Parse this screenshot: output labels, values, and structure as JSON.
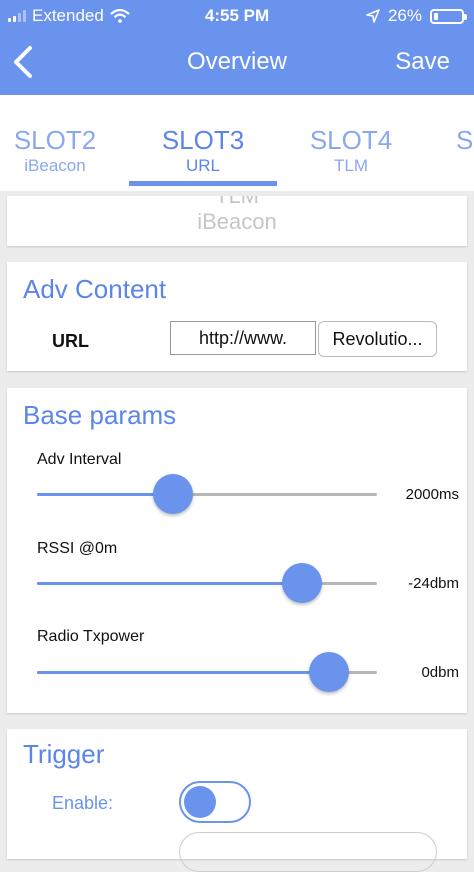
{
  "status_bar": {
    "carrier": "Extended",
    "time": "4:55 PM",
    "battery": "26%",
    "battery_level": 0.26,
    "signal_bars": 2
  },
  "nav": {
    "title": "Overview",
    "save_label": "Save"
  },
  "tabs": [
    {
      "name": "SLOT2",
      "sub": "iBeacon"
    },
    {
      "name": "SLOT3",
      "sub": "URL",
      "active": true
    },
    {
      "name": "SLOT4",
      "sub": "TLM"
    },
    {
      "name": "S",
      "sub": ""
    }
  ],
  "frame_picker": {
    "items": [
      "TLM",
      "iBeacon"
    ]
  },
  "adv_content": {
    "title": "Adv Content",
    "url_label": "URL",
    "url_prefix": "http://www.",
    "url_value": "Revolutio..."
  },
  "base_params": {
    "title": "Base params",
    "params": [
      {
        "label": "Adv Interval",
        "value": "2000ms",
        "level": 0.4
      },
      {
        "label": "RSSI @0m",
        "value": "-24dbm",
        "level": 0.78
      },
      {
        "label": "Radio Txpower",
        "value": "0dbm",
        "level": 0.86
      }
    ]
  },
  "trigger": {
    "title": "Trigger",
    "enable_label": "Enable:",
    "enabled": true
  },
  "colors": {
    "accent": "#6a93ee",
    "tab_inactive": "#8aa8ee",
    "background": "#ececec"
  }
}
